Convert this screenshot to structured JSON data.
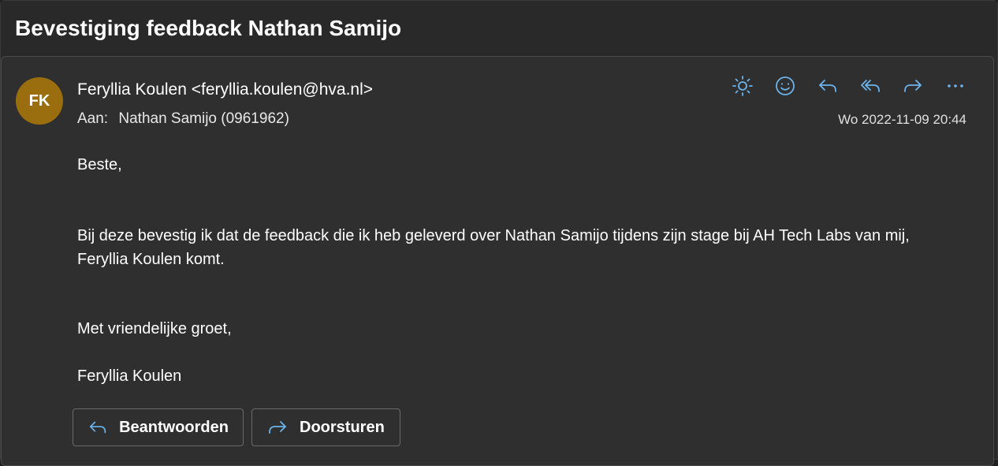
{
  "subject": "Bevestiging feedback Nathan Samijo",
  "message": {
    "avatar_initials": "FK",
    "avatar_color": "#9a6e0f",
    "sender": "Feryllia Koulen <feryllia.koulen@hva.nl>",
    "to_label": "Aan:",
    "to_value": "Nathan Samijo (0961962)",
    "timestamp": "Wo 2022-11-09 20:44",
    "actions": [
      {
        "icon": "sun-icon",
        "label": "Brightness"
      },
      {
        "icon": "smiley-icon",
        "label": "React"
      },
      {
        "icon": "reply-icon",
        "label": "Reply"
      },
      {
        "icon": "reply-all-icon",
        "label": "Reply all"
      },
      {
        "icon": "forward-icon",
        "label": "Forward"
      },
      {
        "icon": "more-icon",
        "label": "More"
      }
    ],
    "body": {
      "greeting": "Beste,",
      "main": "Bij deze bevestig ik dat de feedback die ik heb geleverd over Nathan Samijo tijdens zijn stage bij AH Tech Labs van mij, Feryllia Koulen komt.",
      "closing": "Met vriendelijke groet,",
      "signature": "Feryllia Koulen"
    }
  },
  "reply_buttons": {
    "reply_label": "Beantwoorden",
    "forward_label": "Doorsturen"
  },
  "accent_color": "#6cb4ee"
}
